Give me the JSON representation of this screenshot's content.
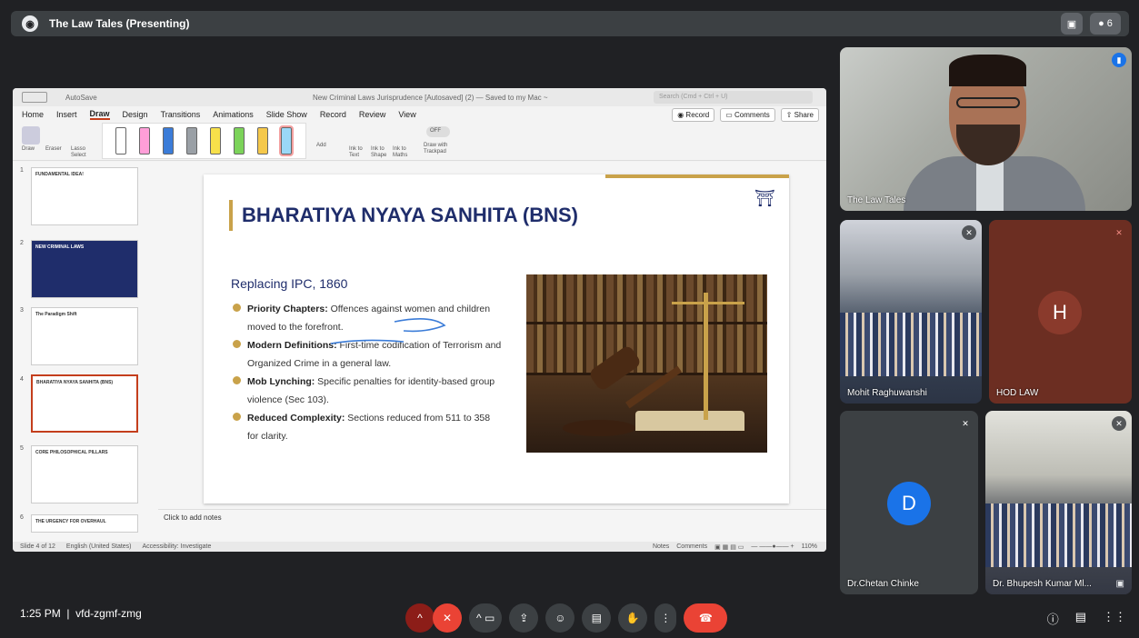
{
  "meeting": {
    "presenting_label": "The Law Tales (Presenting)",
    "time": "1:25 PM",
    "separator": "|",
    "code": "vfd-zgmf-zmg",
    "participant_count": "6"
  },
  "ppt": {
    "autosave": "AutoSave",
    "doc_title": "New Criminal Laws Jurisprudence [Autosaved] (2) — Saved to my Mac ~",
    "search_placeholder": "Search (Cmd + Ctrl + U)",
    "tabs": [
      "Home",
      "Insert",
      "Draw",
      "Design",
      "Transitions",
      "Animations",
      "Slide Show",
      "Record",
      "Review",
      "View"
    ],
    "active_tab": "Draw",
    "record_label": "Record",
    "comments_label": "Comments",
    "share_label": "Share",
    "ribbon": {
      "draw": "Draw",
      "eraser": "Eraser",
      "lasso": "Lasso Select",
      "add": "Add",
      "ink_text": "Ink to Text",
      "ink_shape": "Ink to Shape",
      "ink_maths": "Ink to Maths",
      "off": "OFF",
      "draw_trackpad": "Draw with Trackpad"
    },
    "pen_colors": [
      "#ffffff",
      "#ff9ed8",
      "#3b7cd8",
      "#9aa0a6",
      "#f7e04a",
      "#7cd35a",
      "#f5c84a",
      "#9ad8f7"
    ],
    "thumbnails": [
      {
        "num": "1",
        "text": "FUNDAMENTAL IDEA!"
      },
      {
        "num": "2",
        "text": "NEW CRIMINAL LAWS"
      },
      {
        "num": "3",
        "text": "The Paradigm Shift"
      },
      {
        "num": "4",
        "text": "BHARATIYA NYAYA SANHITA (BNS)"
      },
      {
        "num": "5",
        "text": "CORE PHILOSOPHICAL PILLARS"
      },
      {
        "num": "6",
        "text": "THE URGENCY FOR OVERHAUL"
      }
    ],
    "notes_placeholder": "Click to add notes",
    "status": {
      "slide": "Slide 4 of 12",
      "language": "English (United States)",
      "accessibility": "Accessibility: Investigate",
      "notes": "Notes",
      "comments": "Comments",
      "zoom": "110%"
    }
  },
  "slide": {
    "title": "BHARATIYA NYAYA SANHITA (BNS)",
    "subtitle": "Replacing IPC, 1860",
    "bullets": [
      {
        "bold": "Priority Chapters:",
        "text": " Offences against women and children moved to the forefront."
      },
      {
        "bold": "Modern Definitions:",
        "text": " First-time codification of Terrorism and Organized Crime in a general law."
      },
      {
        "bold": "Mob Lynching:",
        "text": " Specific penalties for identity-based group violence (Sec 103)."
      },
      {
        "bold": "Reduced Complexity:",
        "text": " Sections reduced from 511 to 358 for clarity."
      }
    ]
  },
  "participants": {
    "main": "The Law Tales",
    "mohit": "Mohit Raghuwanshi",
    "hod": "HOD LAW",
    "hod_initial": "H",
    "chetan": "Dr.Chetan Chinke",
    "chetan_initial": "D",
    "bhupesh": "Dr. Bhupesh Kumar Ml..."
  },
  "colors": {
    "end_call": "#ea4335",
    "hod_avatar": "#8a3a2c",
    "chetan_avatar": "#1a73e8",
    "slide_gold": "#c9a24a",
    "slide_navy": "#1f2d6b"
  },
  "icons": {
    "mic_off": "mic-off-icon",
    "camera": "camera-icon",
    "present": "present-icon",
    "emoji": "emoji-icon",
    "captions": "captions-icon",
    "raise_hand": "hand-icon",
    "more": "more-icon",
    "end_call": "end-call-icon",
    "info": "info-icon",
    "chat": "chat-icon",
    "activities": "grid-icon"
  }
}
